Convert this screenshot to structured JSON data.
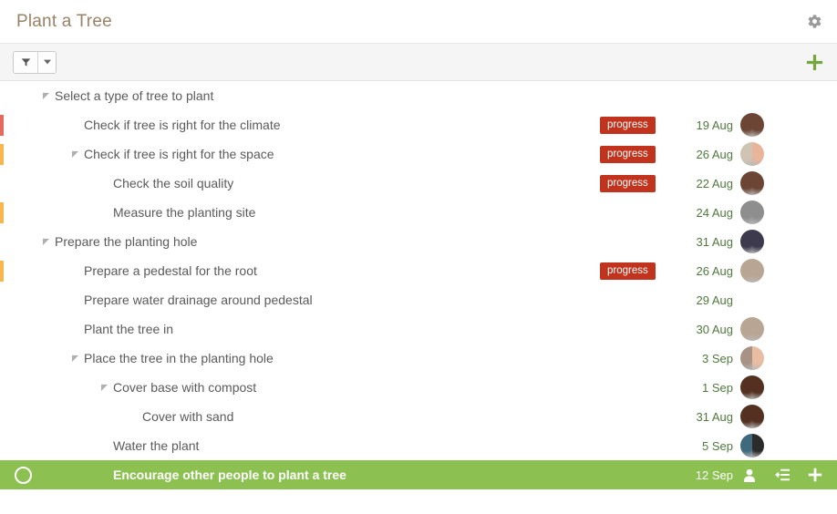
{
  "header": {
    "title": "Plant a Tree",
    "settings_icon": "gear-icon"
  },
  "toolbar": {
    "filter_icon": "funnel-icon",
    "filter_caret_icon": "chevron-down-icon",
    "add_icon": "plus-icon",
    "add_color": "#74a83e"
  },
  "colors": {
    "title": "#9a8267",
    "selected_row": "#8cc152",
    "badge": "#c0341d",
    "date_text": "#4e7a3d",
    "priority_high": "#e4695e",
    "priority_medium": "#f9b64e",
    "task_text": "#5a5a5a"
  },
  "tasks": [
    {
      "name": "Select a type of tree to plant",
      "indent": 0,
      "has_twisty": true,
      "priority": "",
      "badge": "",
      "date": "",
      "avatar": [],
      "selected": false
    },
    {
      "name": "Check if tree is right for the climate",
      "indent": 1,
      "has_twisty": false,
      "priority": "high",
      "badge": "progress",
      "date": "19 Aug",
      "avatar": [
        "#6d4534",
        "#6d4534"
      ],
      "selected": false
    },
    {
      "name": "Check if tree is right for the space",
      "indent": 1,
      "has_twisty": true,
      "priority": "medium",
      "badge": "progress",
      "date": "26 Aug",
      "avatar": [
        "#cfc3b4",
        "#e8b59a"
      ],
      "selected": false
    },
    {
      "name": "Check the soil quality",
      "indent": 2,
      "has_twisty": false,
      "priority": "",
      "badge": "progress",
      "date": "22 Aug",
      "avatar": [
        "#6d4534",
        "#6d4534"
      ],
      "selected": false
    },
    {
      "name": "Measure the planting site",
      "indent": 2,
      "has_twisty": false,
      "priority": "medium",
      "badge": "",
      "date": "24 Aug",
      "avatar": [
        "#8e8e8e",
        "#8e8e8e"
      ],
      "selected": false
    },
    {
      "name": "Prepare the planting hole",
      "indent": 0,
      "has_twisty": true,
      "priority": "",
      "badge": "",
      "date": "31 Aug",
      "avatar": [
        "#3d3a4e",
        "#3d3a4e"
      ],
      "selected": false
    },
    {
      "name": "Prepare a pedestal for the root",
      "indent": 1,
      "has_twisty": false,
      "priority": "medium",
      "badge": "progress",
      "date": "26 Aug",
      "avatar": [
        "#b9a593",
        "#b9a593"
      ],
      "selected": false
    },
    {
      "name": "Prepare water drainage around pedestal",
      "indent": 1,
      "has_twisty": false,
      "priority": "",
      "badge": "",
      "date": "29 Aug",
      "avatar": [],
      "selected": false
    },
    {
      "name": "Plant the tree in",
      "indent": 1,
      "has_twisty": false,
      "priority": "",
      "badge": "",
      "date": "30 Aug",
      "avatar": [
        "#b9a593",
        "#b9a593"
      ],
      "selected": false
    },
    {
      "name": "Place the tree in the planting hole",
      "indent": 1,
      "has_twisty": true,
      "priority": "",
      "badge": "",
      "date": "3 Sep",
      "avatar": [
        "#a89285",
        "#e8bda2"
      ],
      "selected": false
    },
    {
      "name": "Cover base with compost",
      "indent": 2,
      "has_twisty": true,
      "priority": "",
      "badge": "",
      "date": "1 Sep",
      "avatar": [
        "#53301f",
        "#53301f"
      ],
      "selected": false
    },
    {
      "name": "Cover with sand",
      "indent": 3,
      "has_twisty": false,
      "priority": "",
      "badge": "",
      "date": "31 Aug",
      "avatar": [
        "#53301f",
        "#53301f"
      ],
      "selected": false
    },
    {
      "name": "Water the plant",
      "indent": 2,
      "has_twisty": false,
      "priority": "",
      "badge": "",
      "date": "5 Sep",
      "avatar": [
        "#3f6a7e",
        "#2b2b2b"
      ],
      "selected": false
    },
    {
      "name": "Encourage other people to plant a tree",
      "indent": 2,
      "has_twisty": false,
      "priority": "",
      "badge": "",
      "date": "12 Sep",
      "avatar": [],
      "selected": true,
      "actions": [
        "assignee-icon",
        "subtask-icon",
        "add-icon"
      ]
    }
  ]
}
